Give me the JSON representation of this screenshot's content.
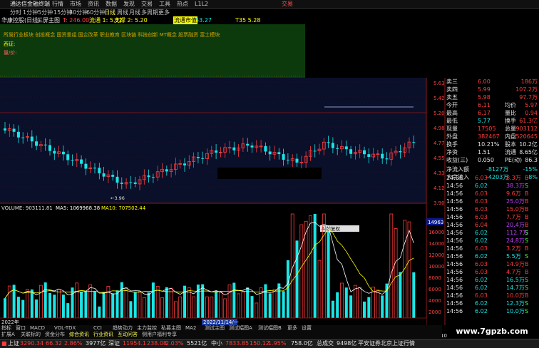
{
  "menubar": {
    "app_title": "通达信金融终端",
    "menus": [
      "行情",
      "市场",
      "资讯",
      "数据",
      "发现",
      "交易",
      "工具",
      "热点",
      "L1L2"
    ],
    "trade_label": "交易"
  },
  "periodbar": {
    "items": [
      "分时",
      "1分钟",
      "5分钟",
      "15分钟",
      "30分钟",
      "60分钟",
      "日线",
      "周线",
      "月线",
      "多周期",
      "更多"
    ]
  },
  "infobar": {
    "left": "华康控股(日线)",
    "indicator": "三屏主图",
    "t_value": "T: 246.00",
    "flow": "流通 1: 5.72",
    "support": "支撑 2: 5.20",
    "circulating": "流通市值",
    "circ_value": "53.27",
    "ts": "T35 5.28"
  },
  "infopanel": {
    "line1": "所属行业板块   创投概念 国资重组 国企改革 职业教育 区块链 科技创新 MT概念 股票融资   富士模块",
    "line2": "西证:",
    "line3": "量/价:"
  },
  "price_axis": [
    "5.63",
    "5.42",
    "5.20",
    "4.98",
    "4.77",
    "4.55",
    "4.33",
    "4.12",
    "3.90"
  ],
  "price_low_label": "3.96",
  "vol_axis": [
    "16000",
    "14000",
    "12000",
    "10000",
    "8000",
    "6000",
    "4000",
    "2000"
  ],
  "vol_bar_label": "14963",
  "volume_title": {
    "vol": "VOLUME: 903111.81",
    "ma5": "MA5: 1069968.38",
    "ma10": "MA10: 707502.44"
  },
  "x_labels": {
    "left": "2022年",
    "cursor": "2022/11/14/一"
  },
  "popup_label": "A 前复权",
  "quote": {
    "rows": [
      {
        "l": "卖三",
        "v": "6.00",
        "r": "",
        "rv": "186万"
      },
      {
        "l": "卖四",
        "v": "5.99",
        "r": "",
        "rv": "107.2万"
      },
      {
        "l": "卖五",
        "v": "5.98",
        "r": "",
        "rv": "97.7万"
      },
      {
        "l": "今开",
        "v": "6.11",
        "r": "均价",
        "rv": "5.97"
      },
      {
        "l": "最高",
        "v": "6.17",
        "r": "量比",
        "rv": "0.94"
      },
      {
        "l": "最低",
        "v": "5.77",
        "r": "换手",
        "rv": "61.3亿"
      },
      {
        "l": "现量",
        "v": "17505",
        "r": "总量",
        "rv": "903112"
      },
      {
        "l": "外盘",
        "v": "382467",
        "r": "内盘",
        "rv": "520645"
      },
      {
        "l": "换手",
        "v": "10.21%",
        "r": "股本",
        "rv": "10.2亿"
      },
      {
        "l": "净资",
        "v": "1.51",
        "r": "流通",
        "rv": "8.65亿"
      },
      {
        "l": "收益(三)",
        "v": "0.050",
        "r": "PE(动)",
        "rv": "86.3"
      }
    ],
    "flow1_label": "净流入额",
    "flow1_value": "-8127万",
    "flow1_pct": "-15%",
    "flow2_label": "大宗流入",
    "flow2_value": "-4203万",
    "flow2_pct": "-8%"
  },
  "ticks": [
    {
      "t": "14:56",
      "p": "6.03",
      "v": "8.3万",
      "s": "B"
    },
    {
      "t": "14:56",
      "p": "6.02",
      "v": "38.3万",
      "s": "S"
    },
    {
      "t": "14:56",
      "p": "6.03",
      "v": "9.6万",
      "s": "B"
    },
    {
      "t": "14:56",
      "p": "6.03",
      "v": "25.0万",
      "s": "B"
    },
    {
      "t": "14:56",
      "p": "6.03",
      "v": "15.0万",
      "s": "B"
    },
    {
      "t": "14:56",
      "p": "6.03",
      "v": "7.7万",
      "s": "B"
    },
    {
      "t": "14:56",
      "p": "6.04",
      "v": "20.4万",
      "s": "B"
    },
    {
      "t": "14:56",
      "p": "6.02",
      "v": "112.7万",
      "s": "S"
    },
    {
      "t": "14:56",
      "p": "6.02",
      "v": "24.8万",
      "s": "S"
    },
    {
      "t": "14:56",
      "p": "6.03",
      "v": "3.2万",
      "s": "B"
    },
    {
      "t": "14:56",
      "p": "6.02",
      "v": "5.5万",
      "s": "S"
    },
    {
      "t": "14:56",
      "p": "6.03",
      "v": "14.9万",
      "s": "B"
    },
    {
      "t": "14:56",
      "p": "6.03",
      "v": "4.7万",
      "s": "B"
    },
    {
      "t": "14:56",
      "p": "6.02",
      "v": "16.5万",
      "s": "S"
    },
    {
      "t": "14:56",
      "p": "6.02",
      "v": "14.7万",
      "s": "S"
    },
    {
      "t": "14:56",
      "p": "6.03",
      "v": "10.0万",
      "s": "B"
    },
    {
      "t": "14:56",
      "p": "6.02",
      "v": "12.3万",
      "s": "S"
    },
    {
      "t": "14:56",
      "p": "6.02",
      "v": "10.0万",
      "s": "S"
    }
  ],
  "tabbar": [
    "指标",
    "窗口",
    "MACD",
    "VOL-TDX",
    "CCI",
    "趋势动力",
    "主力监控",
    "私募主图",
    "MA2",
    "测试主图",
    "测试幅图A",
    "测试幅图B",
    "更多",
    "设置"
  ],
  "tabbar2": [
    "扩展A",
    "关联标的",
    "资金分布",
    "综合资讯",
    "行业资讯",
    "互动问答",
    "侧用户福利专享"
  ],
  "statusbar": {
    "sh_label": "上证",
    "sh_value": "3290.34",
    "sh_change": "66.32",
    "sh_pct": "2.86%",
    "sh_amount": "3977亿",
    "sz_label": "深证",
    "sz_value": "11954.1",
    "sz_change": "238.08",
    "sz_pct": "2.03%",
    "sz_amount": "5521亿",
    "zx_label": "中小",
    "zx_value": "7833.85",
    "zx_change": "150.12",
    "zx_pct": "1.95%",
    "zx_amount": "758.0亿",
    "total_label": "总成交",
    "total_value": "9498亿",
    "broker": "平安证券北京上证行情"
  },
  "side_label": "图文F10",
  "watermark": "www.7gpzb.com",
  "colors": {
    "up": "#ff3c3c",
    "down": "#19e6e6",
    "yellow": "#ffff00",
    "bg": "#000000",
    "panel": "#0c3a0c"
  }
}
